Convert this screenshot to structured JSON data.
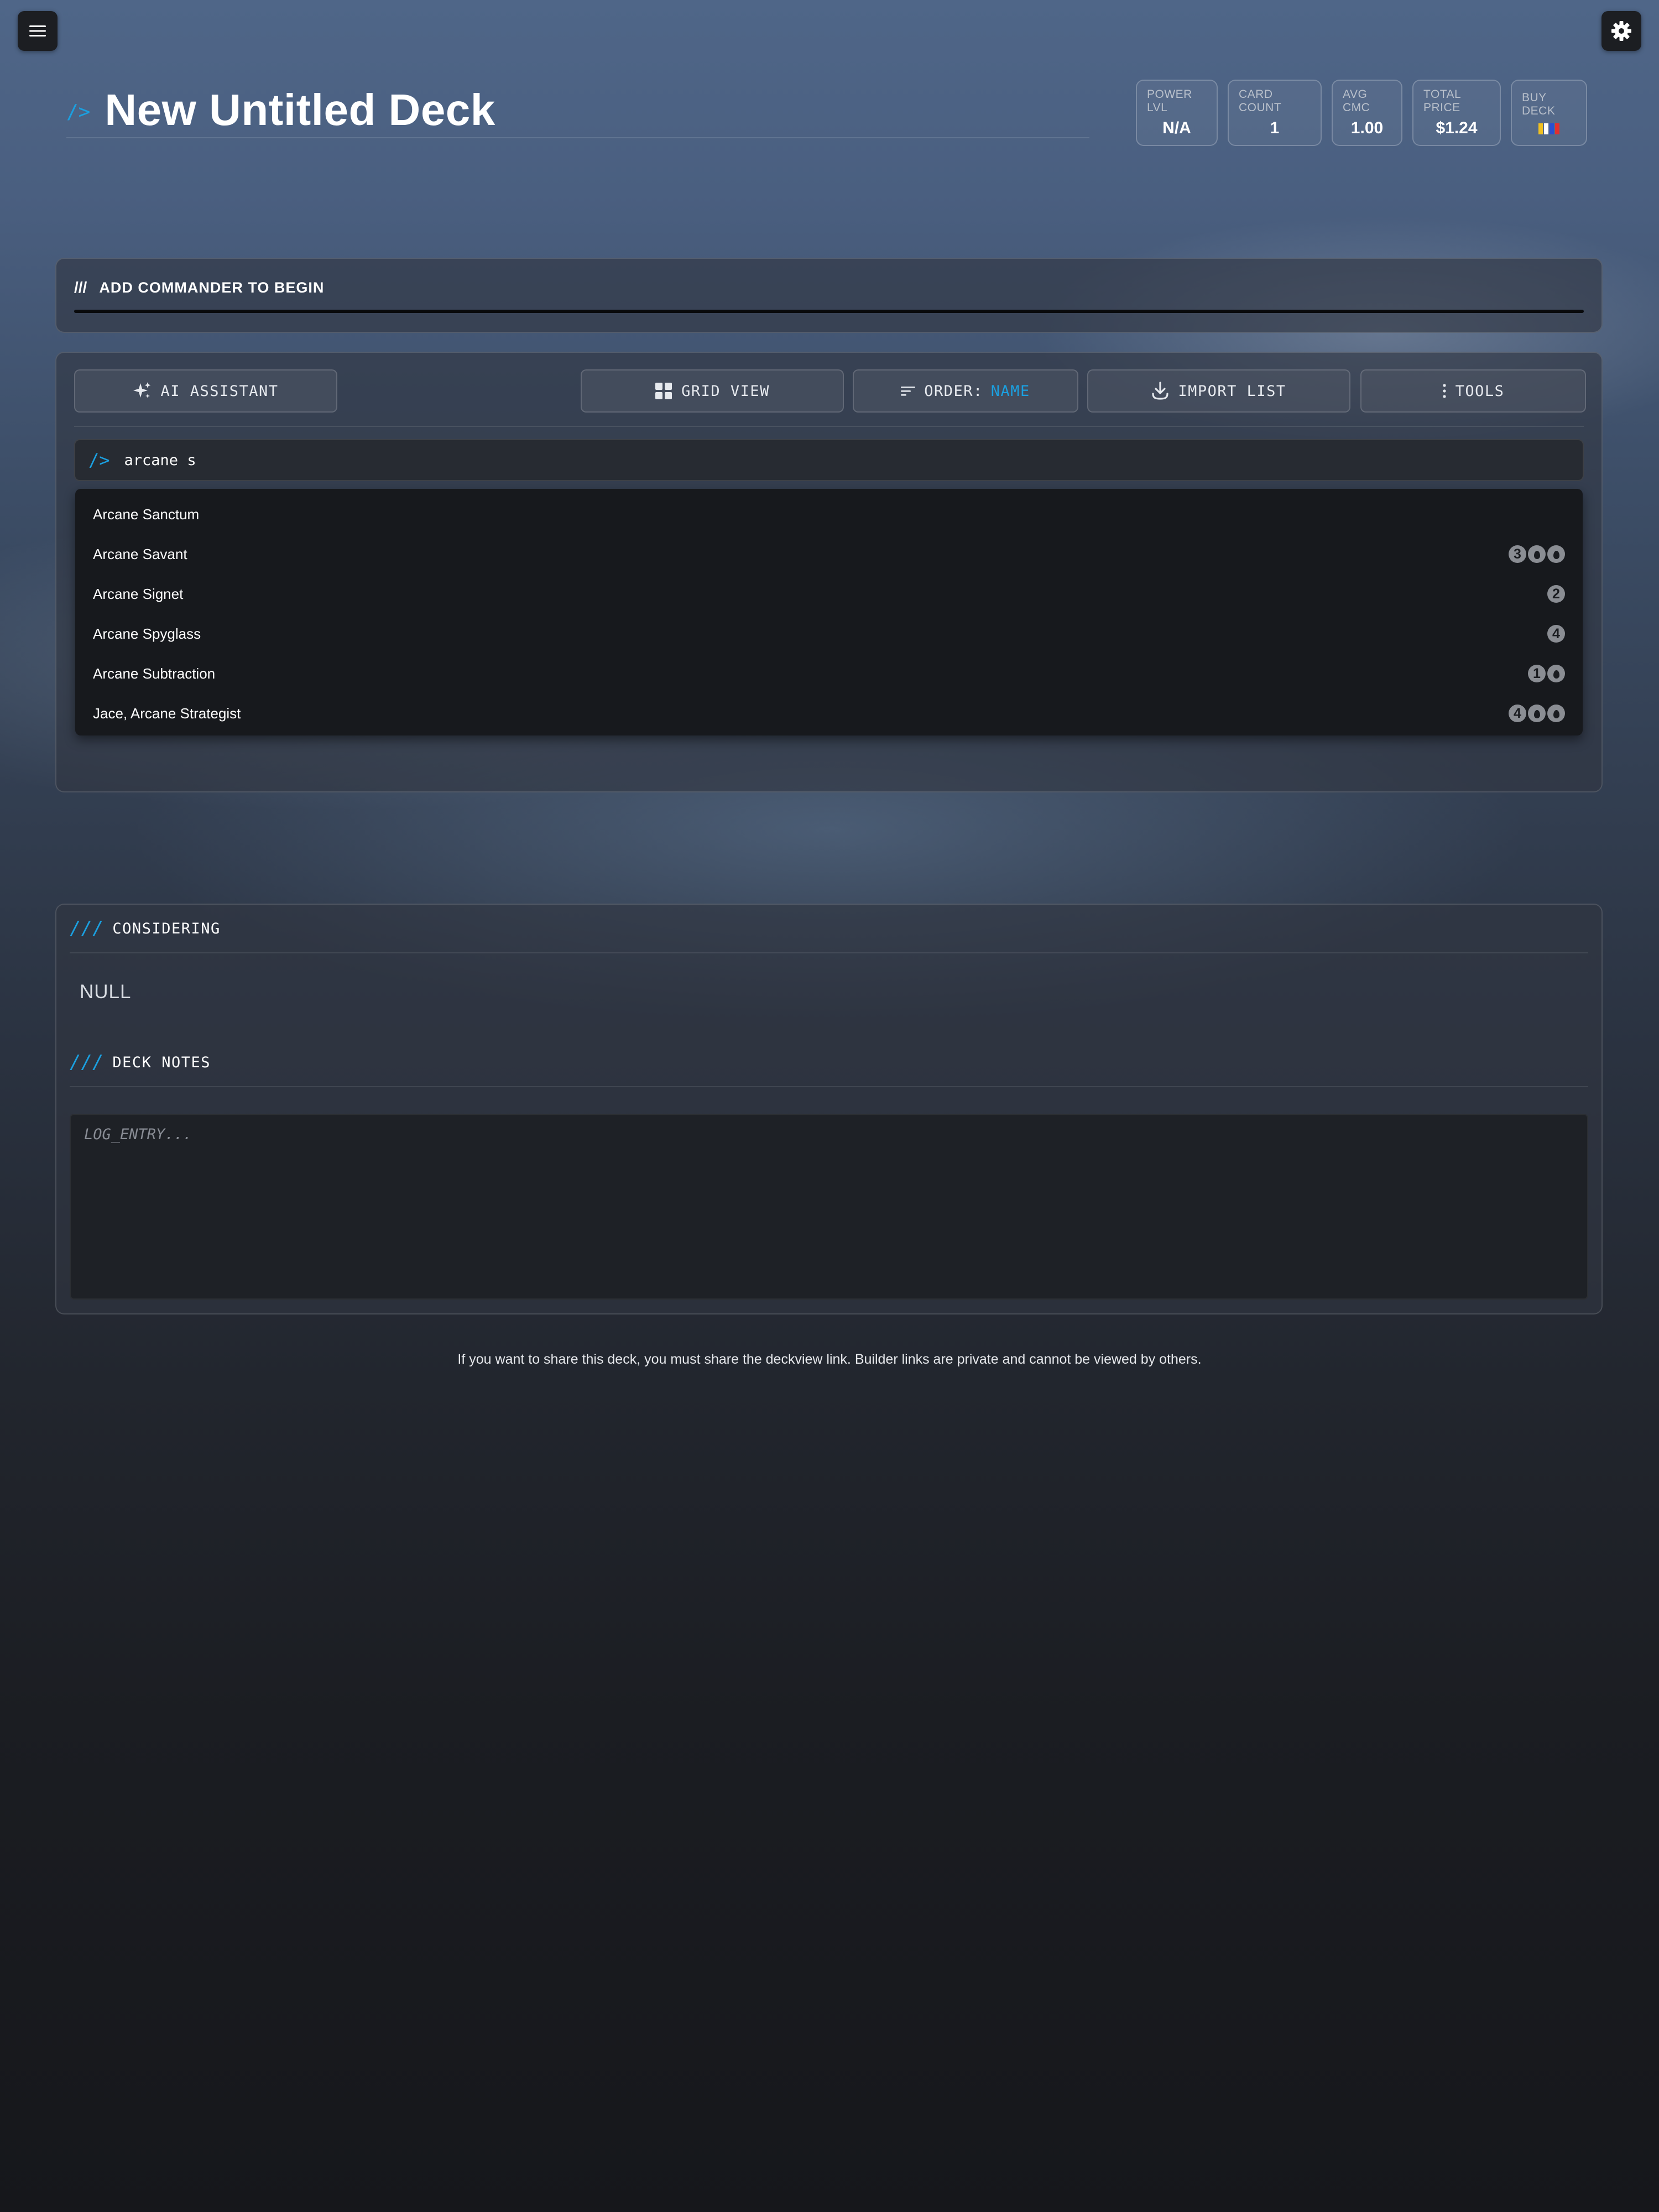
{
  "header": {
    "title_prompt": "/>",
    "title": "New Untitled Deck",
    "accent_color": "#1ba0e0"
  },
  "top_icons": {
    "menu": "hamburger-menu-icon",
    "settings": "gear-icon"
  },
  "stats": {
    "power_label": "POWER LVL",
    "power_value": "N/A",
    "count_label": "CARD COUNT",
    "count_value": "1",
    "cmc_label": "AVG CMC",
    "cmc_value": "1.00",
    "price_label": "TOTAL PRICE",
    "price_value": "$1.24",
    "buy_label": "BUY DECK",
    "buy_icon": "flag-icon"
  },
  "commander": {
    "slashes": "///",
    "label": "ADD COMMANDER TO BEGIN"
  },
  "toolbar": {
    "ai_label": "AI ASSISTANT",
    "grid_label": "GRID VIEW",
    "order_prefix": "ORDER:",
    "order_value": "NAME",
    "import_label": "IMPORT LIST",
    "tools_label": "TOOLS"
  },
  "search": {
    "prompt": "/>",
    "value": "arcane s"
  },
  "results": [
    {
      "name": "Arcane Sanctum",
      "cost": []
    },
    {
      "name": "Arcane Savant",
      "cost": [
        "3",
        "U",
        "U"
      ]
    },
    {
      "name": "Arcane Signet",
      "cost": [
        "2"
      ]
    },
    {
      "name": "Arcane Spyglass",
      "cost": [
        "4"
      ]
    },
    {
      "name": "Arcane Subtraction",
      "cost": [
        "1",
        "U"
      ]
    },
    {
      "name": "Jace, Arcane Strategist",
      "cost": [
        "4",
        "U",
        "U"
      ]
    }
  ],
  "considering": {
    "slashes": "///",
    "title": "CONSIDERING",
    "empty_text": "NULL"
  },
  "notes": {
    "slashes": "///",
    "title": "DECK NOTES",
    "placeholder": "LOG_ENTRY..."
  },
  "footer": {
    "share_note": "If you want to share this deck, you must share the deckview link. Builder links are private and cannot be viewed by others."
  }
}
